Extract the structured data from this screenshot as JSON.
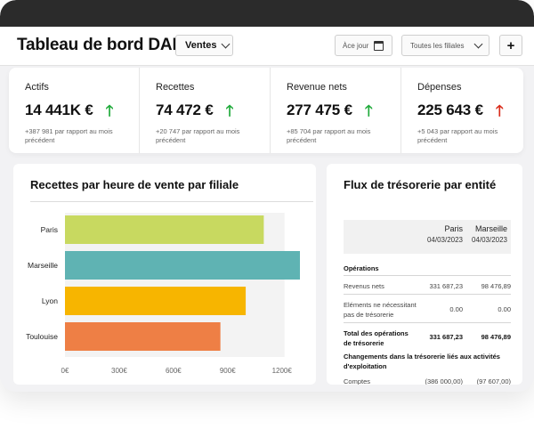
{
  "header": {
    "title": "Tableau de bord DAF",
    "view_select": "Ventes",
    "date_placeholder": "Àce jour",
    "filiales_select": "Toutes les filiales",
    "add_label": "+"
  },
  "kpis": [
    {
      "label": "Actifs",
      "value": "14 441K €",
      "trend": "up",
      "delta": "+387 981 par rapport au mois précédent"
    },
    {
      "label": "Recettes",
      "value": "74 472 €",
      "trend": "up",
      "delta": "+20 747 par rapport au mois précédent"
    },
    {
      "label": "Revenue nets",
      "value": "277 475 €",
      "trend": "up",
      "delta": "+85 704 par rapport au mois précédent"
    },
    {
      "label": "Dépenses",
      "value": "225 643 €",
      "trend": "down",
      "delta": "+5 043 par rapport au mois précédent"
    }
  ],
  "colors": {
    "up_arrow": "#1faa3a",
    "down_arrow": "#d92b1a",
    "bar_paris": "#c8d960",
    "bar_marseille": "#5fb3b3",
    "bar_lyon": "#f7b500",
    "bar_toulouse": "#ee7f45"
  },
  "revenue_chart": {
    "title": "Recettes par heure de vente par filiale"
  },
  "chart_data": {
    "type": "bar",
    "orientation": "horizontal",
    "title": "Recettes par heure de vente par filiale",
    "categories": [
      "Paris",
      "Marseille",
      "Lyon",
      "Toulouise"
    ],
    "values": [
      1100,
      1300,
      1000,
      860
    ],
    "xlabel": "",
    "ylabel": "",
    "xlim": [
      0,
      1300
    ],
    "x_ticks": [
      "0€",
      "300€",
      "600€",
      "900€",
      "1200€"
    ],
    "grid": false
  },
  "cashflow": {
    "title": "Flux de trésorerie par entité",
    "columns": [
      {
        "name": "Paris",
        "date": "04/03/2023"
      },
      {
        "name": "Marseille",
        "date": "04/03/2023"
      }
    ],
    "sections": {
      "operations": "Opérations",
      "changes": "Changements dans la trésorerie liés aux activités d'exploitation"
    },
    "rows": [
      {
        "label": "Revenus nets",
        "paris": "331 687,23",
        "marseille": "98 476,89"
      },
      {
        "label": "Eléments ne nécessitant pas de trésorerie",
        "paris": "0.00",
        "marseille": "0.00"
      },
      {
        "label": "Total des opérations de trésorerie",
        "paris": "331 687,23",
        "marseille": "98 476,89"
      },
      {
        "label": "Comptes",
        "paris": "(386 000,00)",
        "marseille": "(97 607,00)"
      }
    ]
  }
}
